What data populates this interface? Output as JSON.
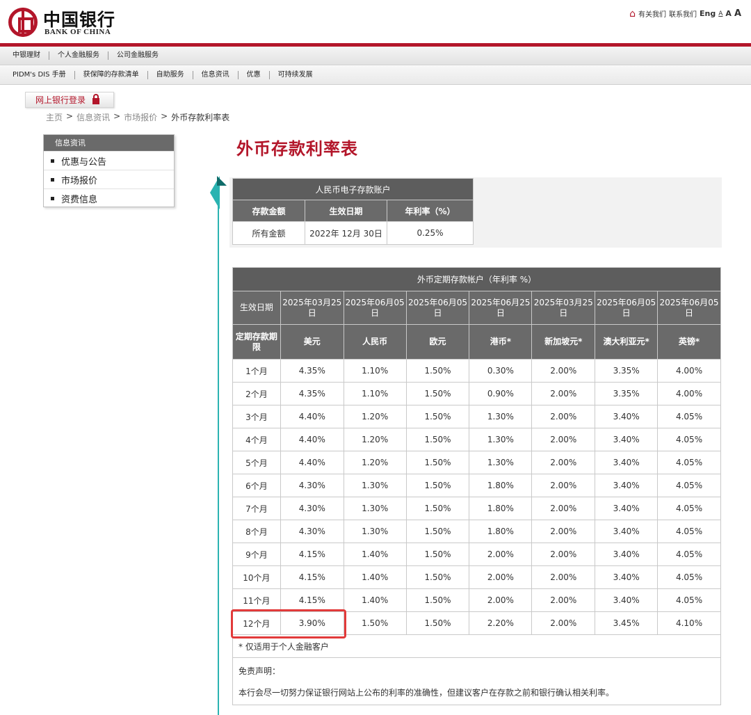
{
  "header": {
    "logo_cn": "中国银行",
    "logo_en": "BANK OF CHINA",
    "top_links": [
      "有关我们",
      "联系我们",
      "Eng"
    ],
    "font_sizes": [
      "A",
      "A",
      "A"
    ]
  },
  "nav_primary": [
    "中银理财",
    "个人金融服务",
    "公司金融服务"
  ],
  "nav_secondary": [
    "PIDM's DIS 手册",
    "获保障的存款清单",
    "自助服务",
    "信息资讯",
    "优惠",
    "可持续发展"
  ],
  "login": {
    "label": "网上银行登录"
  },
  "breadcrumb": {
    "items": [
      "主页",
      "信息资讯",
      "市场报价",
      "外币存款利率表"
    ],
    "sep": ">"
  },
  "sidebar": {
    "title": "信息资讯",
    "items": [
      "优惠与公告",
      "市场报价",
      "资费信息"
    ]
  },
  "page_title": "外币存款利率表",
  "rmb_table": {
    "title": "人民币电子存款账户",
    "headers": [
      "存款金额",
      "生效日期",
      "年利率（%）"
    ],
    "row": [
      "所有金额",
      "2022年 12月 30日",
      "0.25%"
    ]
  },
  "fx_table": {
    "title": "外币定期存款帐户（年利率 %）",
    "date_label": "生效日期",
    "dates": [
      "2025年03月25日",
      "2025年06月05日",
      "2025年06月05日",
      "2025年06月25日",
      "2025年03月25日",
      "2025年06月05日",
      "2025年06月05日"
    ],
    "term_label": "定期存款期限",
    "currencies": [
      "美元",
      "人民币",
      "欧元",
      "港币*",
      "新加坡元*",
      "澳大利亚元*",
      "英镑*"
    ],
    "rows": [
      [
        "1个月",
        "4.35%",
        "1.10%",
        "1.50%",
        "0.30%",
        "2.00%",
        "3.35%",
        "4.00%"
      ],
      [
        "2个月",
        "4.35%",
        "1.10%",
        "1.50%",
        "0.90%",
        "2.00%",
        "3.35%",
        "4.00%"
      ],
      [
        "3个月",
        "4.40%",
        "1.20%",
        "1.50%",
        "1.30%",
        "2.00%",
        "3.40%",
        "4.05%"
      ],
      [
        "4个月",
        "4.40%",
        "1.20%",
        "1.50%",
        "1.30%",
        "2.00%",
        "3.40%",
        "4.05%"
      ],
      [
        "5个月",
        "4.40%",
        "1.20%",
        "1.50%",
        "1.30%",
        "2.00%",
        "3.40%",
        "4.05%"
      ],
      [
        "6个月",
        "4.30%",
        "1.30%",
        "1.50%",
        "1.80%",
        "2.00%",
        "3.40%",
        "4.05%"
      ],
      [
        "7个月",
        "4.30%",
        "1.30%",
        "1.50%",
        "1.80%",
        "2.00%",
        "3.40%",
        "4.05%"
      ],
      [
        "8个月",
        "4.30%",
        "1.30%",
        "1.50%",
        "1.80%",
        "2.00%",
        "3.40%",
        "4.05%"
      ],
      [
        "9个月",
        "4.15%",
        "1.40%",
        "1.50%",
        "2.00%",
        "2.00%",
        "3.40%",
        "4.05%"
      ],
      [
        "10个月",
        "4.15%",
        "1.40%",
        "1.50%",
        "2.00%",
        "2.00%",
        "3.40%",
        "4.05%"
      ],
      [
        "11个月",
        "4.15%",
        "1.40%",
        "1.50%",
        "2.00%",
        "2.00%",
        "3.40%",
        "4.05%"
      ],
      [
        "12个月",
        "3.90%",
        "1.50%",
        "1.50%",
        "2.20%",
        "2.00%",
        "3.45%",
        "4.10%"
      ]
    ],
    "note": "* 仅适用于个人金融客户",
    "disclaimer_title": "免责声明：",
    "disclaimer_text": "本行会尽一切努力保证银行网站上公布的利率的准确性，但建议客户在存款之前和银行确认相关利率。"
  },
  "colors": {
    "brand_red": "#b3162a",
    "timeline_teal": "#2ab3b1",
    "header_gray": "#5d5d5d",
    "highlight_red": "#e23a3a"
  }
}
